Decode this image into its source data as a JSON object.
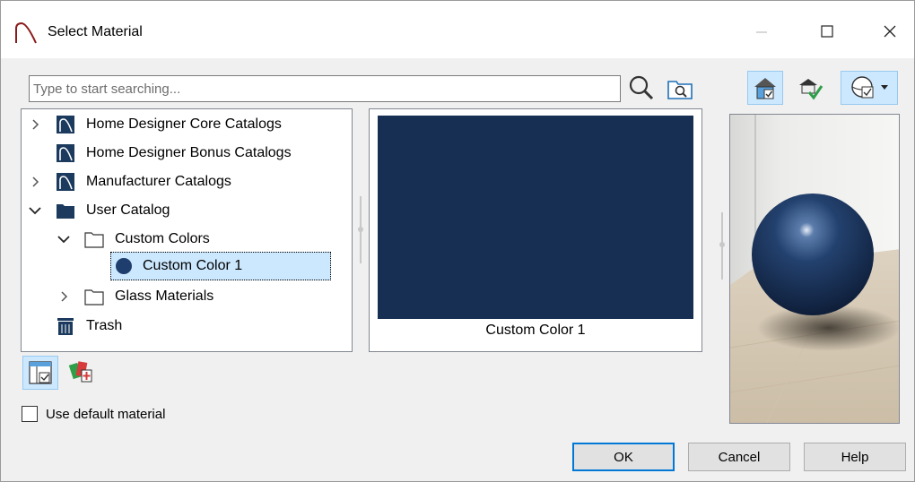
{
  "window": {
    "title": "Select Material"
  },
  "search": {
    "placeholder": "Type to start searching..."
  },
  "tree": {
    "items": [
      {
        "label": "Home Designer Core Catalogs",
        "icon": "catalog-library-icon",
        "expander": "collapsed"
      },
      {
        "label": "Home Designer Bonus Catalogs",
        "icon": "catalog-library-icon",
        "expander": "none"
      },
      {
        "label": "Manufacturer Catalogs",
        "icon": "catalog-library-icon",
        "expander": "collapsed"
      },
      {
        "label": "User Catalog",
        "icon": "folder-filled-icon",
        "expander": "expanded"
      },
      {
        "label": "Custom Colors",
        "icon": "folder-outline-icon",
        "expander": "expanded"
      },
      {
        "label": "Custom Color 1",
        "icon": "color-dot-icon",
        "expander": "none",
        "selected": true,
        "color": "#1f3e6e"
      },
      {
        "label": "Glass Materials",
        "icon": "folder-outline-icon",
        "expander": "collapsed"
      },
      {
        "label": "Trash",
        "icon": "trash-icon",
        "expander": "none"
      }
    ]
  },
  "preview": {
    "label": "Custom Color 1",
    "color": "#162f52"
  },
  "options": {
    "use_default_label": "Use default material",
    "use_default_checked": false
  },
  "buttons": {
    "ok": "OK",
    "cancel": "Cancel",
    "help": "Help"
  },
  "colors": {
    "accent": "#0078d7",
    "selection": "#cce8ff",
    "material": "#162f52"
  }
}
